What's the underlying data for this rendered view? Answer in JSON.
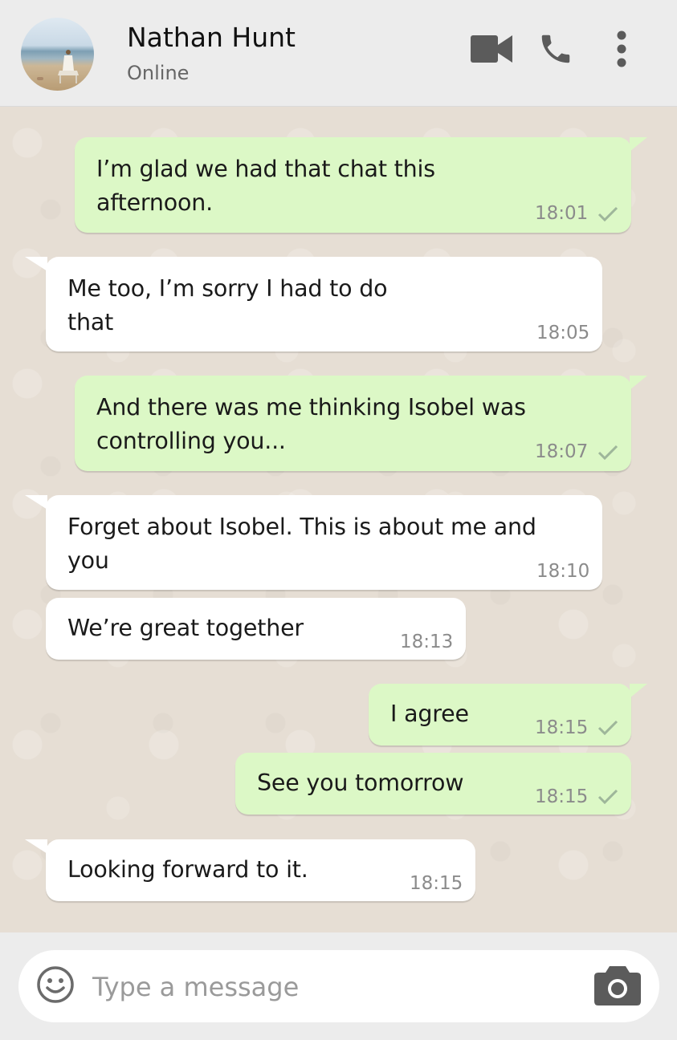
{
  "contact": {
    "name": "Nathan Hunt",
    "status": "Online",
    "avatar": "avatar-photo-beach"
  },
  "header_icons": [
    "video-camera-icon",
    "phone-icon",
    "more-vertical-icon"
  ],
  "messages": [
    {
      "direction": "outgoing",
      "lines": [
        "I’m glad we had that chat this",
        "afternoon."
      ],
      "time": "18:01",
      "read_check": true
    },
    {
      "direction": "incoming",
      "lines": [
        "Me too, I’m sorry I had to do",
        "that"
      ],
      "time": "18:05"
    },
    {
      "direction": "outgoing",
      "lines": [
        "And there was me thinking Isobel was",
        "controlling you..."
      ],
      "time": "18:07",
      "read_check": true
    },
    {
      "direction": "incoming",
      "lines": [
        "Forget about Isobel. This is about me and",
        "you"
      ],
      "time": "18:10"
    },
    {
      "direction": "incoming",
      "lines": [
        "We’re great together"
      ],
      "time": "18:13"
    },
    {
      "direction": "outgoing",
      "lines": [
        "I agree"
      ],
      "time": "18:15",
      "read_check": true
    },
    {
      "direction": "outgoing",
      "lines": [
        "See you tomorrow"
      ],
      "time": "18:15",
      "read_check": true
    },
    {
      "direction": "incoming",
      "lines": [
        "Looking forward to it."
      ],
      "time": "18:15"
    }
  ],
  "composer": {
    "placeholder": "Type a message",
    "emoji_icon": "emoji-icon",
    "camera_icon": "camera-icon"
  },
  "colors": {
    "outgoing_bubble": "#dcf8c6",
    "incoming_bubble": "#ffffff",
    "chat_background": "#e6ded4",
    "header_background": "#ececec",
    "check_color": "#9eb69a"
  }
}
